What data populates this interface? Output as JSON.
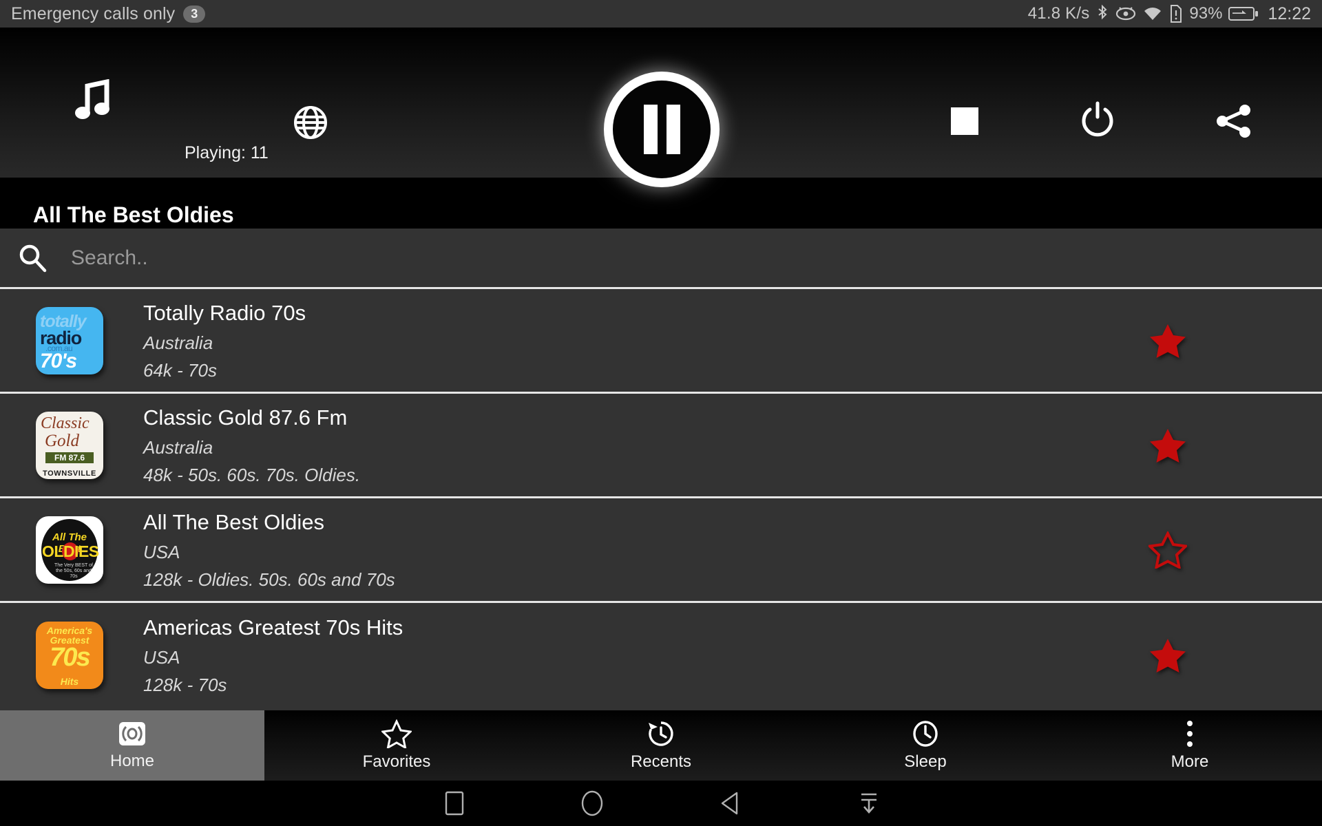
{
  "statusbar": {
    "carrier": "Emergency calls only",
    "notification_count": "3",
    "network_speed": "41.8 K/s",
    "battery_percent": "93%",
    "time": "12:22",
    "icons": [
      "bluetooth-icon",
      "eye-care-icon",
      "wifi-icon",
      "sim-alert-icon",
      "battery-charging-icon"
    ]
  },
  "player": {
    "music_icon": "music-note-icon",
    "globe_icon": "globe-icon",
    "playing_label": "Playing: 11",
    "pause_icon": "pause-icon",
    "stop_icon": "stop-icon",
    "power_icon": "power-icon",
    "share_icon": "share-icon",
    "now_playing_title": "All The Best Oldies"
  },
  "search": {
    "icon": "search-icon",
    "placeholder": "Search..",
    "value": ""
  },
  "stations": [
    {
      "name": "Totally Radio 70s",
      "country": "Australia",
      "meta": "64k - 70s",
      "favorite": true,
      "logo": "totally-radio-70s-logo",
      "logo_text": {
        "l1": "totally",
        "l2": "radio",
        "l3": ".com.au",
        "l4": "70's"
      }
    },
    {
      "name": "Classic Gold 87.6 Fm",
      "country": "Australia",
      "meta": "48k - 50s. 60s. 70s. Oldies.",
      "favorite": true,
      "logo": "classic-gold-logo",
      "logo_text": {
        "l1": "Classic",
        "l2": "Gold",
        "l3": "FM 87.6",
        "l4": "TOWNSVILLE"
      }
    },
    {
      "name": "All The Best Oldies",
      "country": "USA",
      "meta": "128k - Oldies. 50s. 60s and 70s",
      "favorite": false,
      "logo": "all-the-best-oldies-logo",
      "logo_text": {
        "l1": "All The Best",
        "l2": "OLDIES",
        "l3": "The Very BEST of the 50s, 60s and 70s"
      }
    },
    {
      "name": "Americas Greatest 70s Hits",
      "country": "USA",
      "meta": "128k - 70s",
      "favorite": true,
      "logo": "americas-greatest-70s-hits-logo",
      "logo_text": {
        "l1": "America's",
        "l2": "Greatest",
        "l3": "70s",
        "l4": "Hits"
      }
    }
  ],
  "tabs": [
    {
      "label": "Home",
      "icon": "broadcast-icon",
      "active": true
    },
    {
      "label": "Favorites",
      "icon": "star-outline-icon",
      "active": false
    },
    {
      "label": "Recents",
      "icon": "history-icon",
      "active": false
    },
    {
      "label": "Sleep",
      "icon": "clock-icon",
      "active": false
    },
    {
      "label": "More",
      "icon": "overflow-menu-icon",
      "active": false
    }
  ],
  "navbar": {
    "recents_icon": "square-recents-icon",
    "home_icon": "circle-home-icon",
    "back_icon": "triangle-back-icon",
    "hide_icon": "hide-navbar-icon"
  },
  "colors": {
    "favorite_star": "#c40c0c",
    "panel_bg": "#333333",
    "divider": "#e6e6e6",
    "active_tab": "#6e6e6e"
  }
}
